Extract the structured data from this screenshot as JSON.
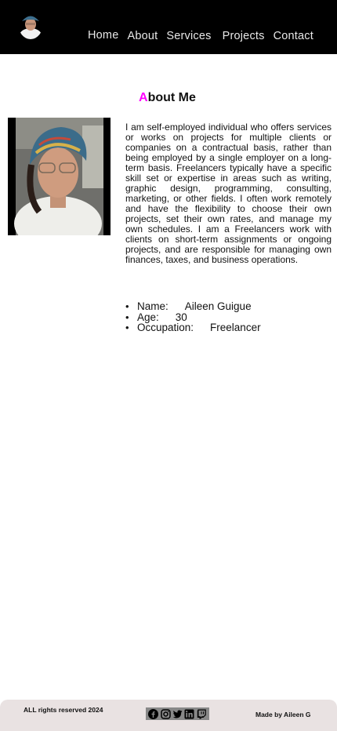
{
  "nav": {
    "links": [
      "Home",
      "About",
      "Services",
      "Projects",
      "Contact"
    ],
    "logo_icon": "avatar-icon"
  },
  "about": {
    "title_accent": "A",
    "title_rest": "bout Me",
    "accent_color": "#ff00ff",
    "paragraph": "I am self-employed individual who offers services or works on projects for multiple clients or companies on a contractual basis, rather than being employed by a single employer on a long-term basis. Freelancers typically have a specific skill set or expertise in areas such as writing, graphic design, programming, consulting, marketing, or other fields. I often work remotely and have the flexibility to choose their own projects, set their own rates, and manage my own schedules. I am a Freelancers work with clients on short-term assignments or ongoing projects, and are responsible for managing own finances, taxes, and business operations.",
    "info": [
      {
        "label": "Name:",
        "value": "Aileen Guigue"
      },
      {
        "label": "Age:",
        "value": "30"
      },
      {
        "label": "Occupation:",
        "value": "Freelancer"
      }
    ]
  },
  "footer": {
    "rights": "ALL rights reserved 2024",
    "made_by": "Made by Aileen G",
    "social_icons": [
      "facebook-icon",
      "instagram-icon",
      "twitter-icon",
      "linkedin-icon",
      "twitch-icon"
    ]
  }
}
